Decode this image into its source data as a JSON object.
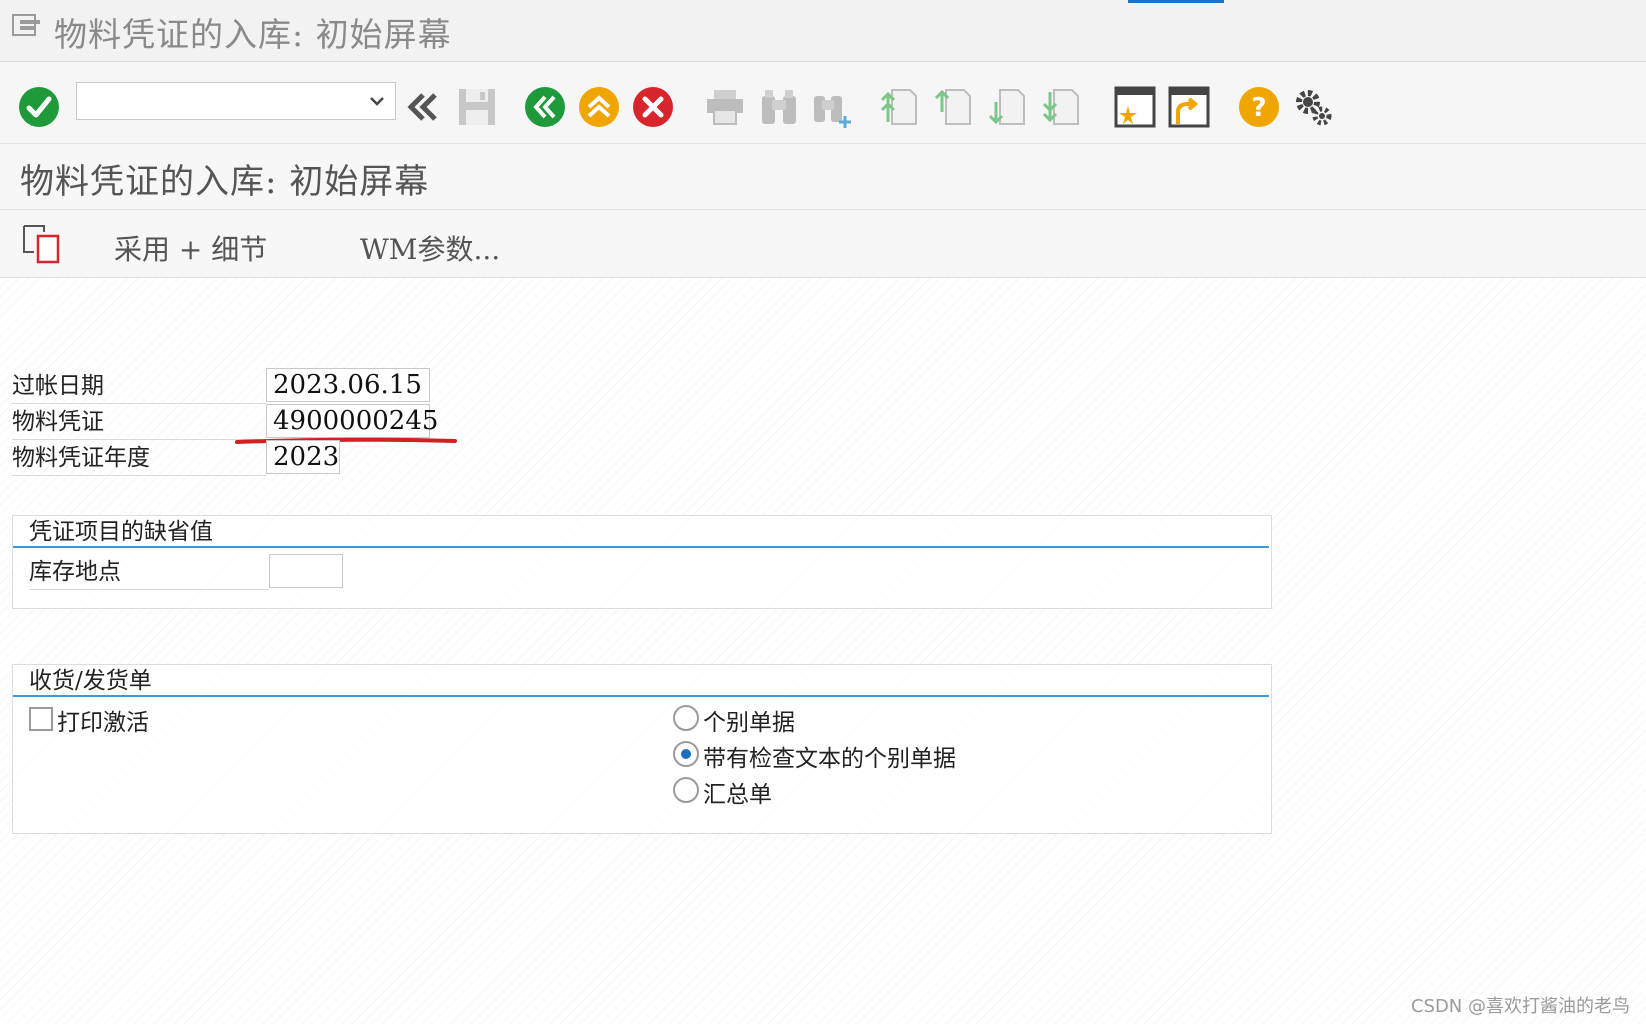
{
  "window": {
    "title": "物料凭证的入库: 初始屏幕"
  },
  "toolbar": {
    "command_field_value": "",
    "buttons": [
      "enter-check-icon",
      "command-dropdown-icon",
      "collapse-icon",
      "save-icon",
      "back-icon",
      "exit-icon",
      "cancel-icon",
      "print-icon",
      "find-icon",
      "find-next-icon",
      "first-page-icon",
      "previous-page-icon",
      "next-page-icon",
      "last-page-icon",
      "new-session-icon",
      "shortcut-icon",
      "help-icon",
      "settings-icon"
    ]
  },
  "screen": {
    "title": "物料凭证的入库: 初始屏幕"
  },
  "app_toolbar": {
    "adopt_detail_label": "采用 + 细节",
    "wm_params_label": "WM参数..."
  },
  "header_fields": [
    {
      "label": "过帐日期",
      "value": "2023.06.15"
    },
    {
      "label": "物料凭证",
      "value": "4900000245"
    },
    {
      "label": "物料凭证年度",
      "value": "2023"
    }
  ],
  "defaults_group": {
    "title": "凭证项目的缺省值",
    "storage_location_label": "库存地点",
    "storage_location_value": ""
  },
  "slip_group": {
    "title": "收货/发货单",
    "print_active_label": "打印激活",
    "print_active_checked": false,
    "options": [
      "个别单据",
      "带有检查文本的个别单据",
      "汇总单"
    ],
    "selected_option": "带有检查文本的个别单据"
  },
  "colors": {
    "success": "#2a9a3c",
    "warning": "#f0a500",
    "error": "#d7262b",
    "accent": "#1a73c7",
    "annotation": "#d32020"
  },
  "watermark": "CSDN @喜欢打酱油的老鸟"
}
